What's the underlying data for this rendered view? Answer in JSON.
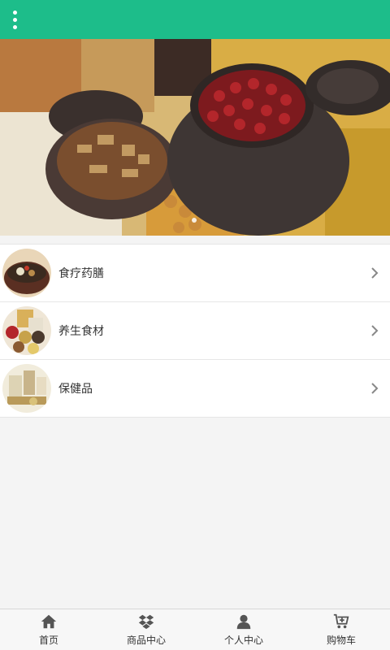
{
  "header": {
    "menu_icon": "more-vertical-icon",
    "bg_color": "#1dbd8a"
  },
  "banner": {
    "image": "grains-and-red-beans-photo"
  },
  "categories": [
    {
      "label": "食疗药膳",
      "thumb": "herbal-soup-photo"
    },
    {
      "label": "养生食材",
      "thumb": "grains-photo"
    },
    {
      "label": "保健品",
      "thumb": "health-products-photo"
    }
  ],
  "tabbar": [
    {
      "label": "首页",
      "icon": "home-icon"
    },
    {
      "label": "商品中心",
      "icon": "dropbox-icon"
    },
    {
      "label": "个人中心",
      "icon": "user-icon"
    },
    {
      "label": "购物车",
      "icon": "cart-icon"
    }
  ]
}
